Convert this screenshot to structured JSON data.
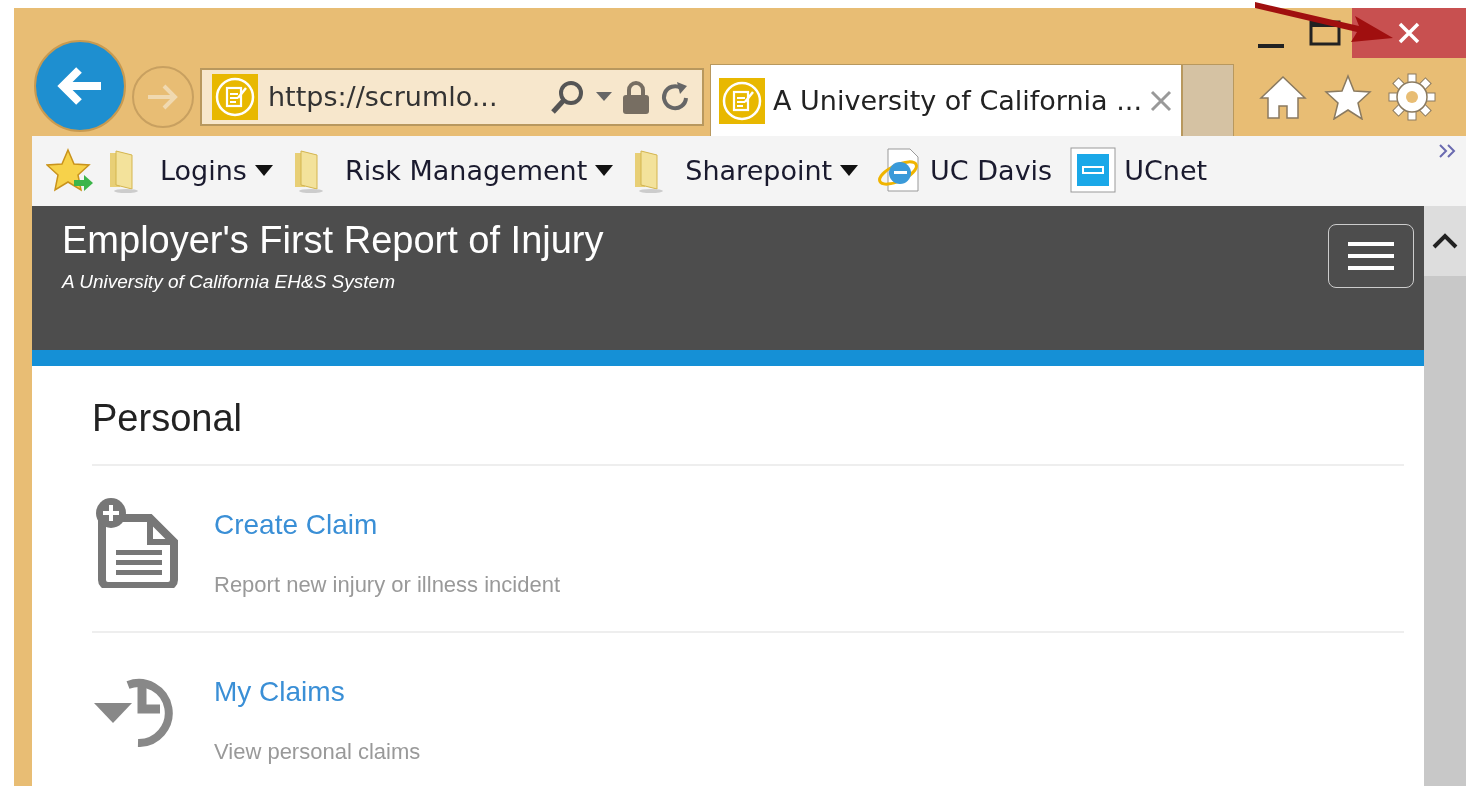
{
  "browser": {
    "address_bar": {
      "url": "https://scrumlo..."
    },
    "tab": {
      "title": "A University of California ..."
    }
  },
  "favorites": [
    {
      "label": "Logins",
      "kind": "folder",
      "dropdown": true
    },
    {
      "label": "Risk Management",
      "kind": "folder",
      "dropdown": true
    },
    {
      "label": "Sharepoint",
      "kind": "folder",
      "dropdown": true
    },
    {
      "label": "UC Davis",
      "kind": "ie-page",
      "dropdown": false
    },
    {
      "label": "UCnet",
      "kind": "app-page",
      "dropdown": false
    }
  ],
  "header": {
    "title": "Employer's First Report of Injury",
    "subtitle": "A University of California EH&S System"
  },
  "section": {
    "heading": "Personal",
    "actions": [
      {
        "kind": "create",
        "title": "Create Claim",
        "description": "Report new injury or illness incident"
      },
      {
        "kind": "history",
        "title": "My Claims",
        "description": "View personal claims"
      }
    ]
  }
}
